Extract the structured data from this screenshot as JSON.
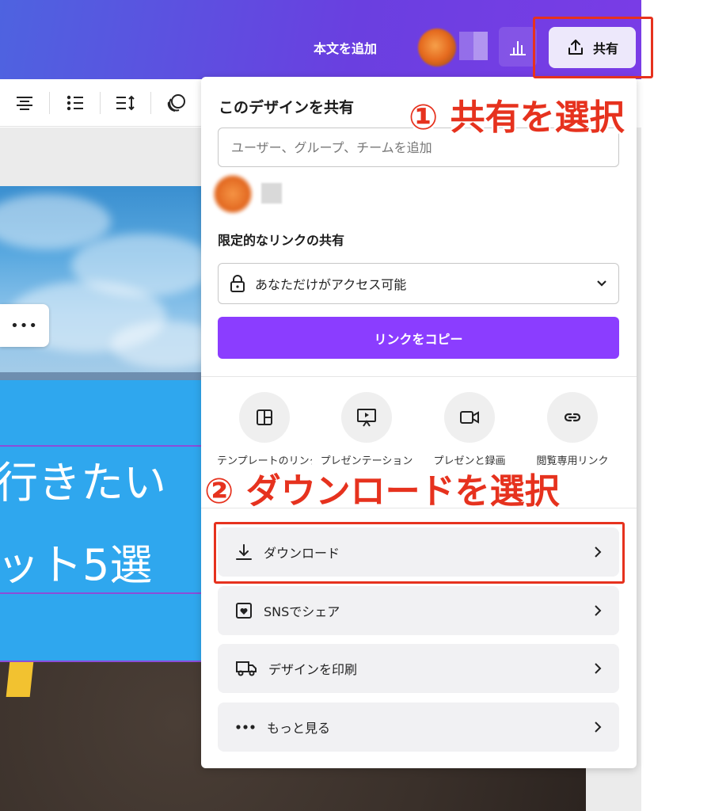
{
  "header": {
    "add_text_label": "本文を追加",
    "share_label": "共有"
  },
  "canvas": {
    "title_line1": "行きたい",
    "title_line2": "ット5選",
    "more_menu": "•••"
  },
  "share_panel": {
    "title": "このデザインを共有",
    "people_placeholder": "ユーザー、グループ、チームを追加",
    "link_section_label": "限定的なリンクの共有",
    "access_value": "あなただけがアクセス可能",
    "copy_link_label": "リンクをコピー",
    "quick_actions": [
      {
        "label": "テンプレートのリンク",
        "icon": "template-icon"
      },
      {
        "label": "プレゼンテーション",
        "icon": "presentation-icon"
      },
      {
        "label": "プレゼンと録画",
        "icon": "video-camera-icon"
      },
      {
        "label": "閲覧専用リンク",
        "icon": "link-icon"
      }
    ],
    "actions": [
      {
        "label": "ダウンロード",
        "icon": "download-icon"
      },
      {
        "label": "SNSでシェア",
        "icon": "heart-card-icon"
      },
      {
        "label": "デザインを印刷",
        "icon": "truck-icon"
      },
      {
        "label": "もっと見る",
        "icon": "more-dots-icon"
      }
    ]
  },
  "annotations": {
    "step1": "① 共有を選択",
    "step2": "② ダウンロードを選択"
  },
  "colors": {
    "header_gradient_start": "#4e63e0",
    "header_gradient_end": "#7a3ce6",
    "primary_button": "#8b3dff",
    "annotation_red": "#e6321e"
  }
}
